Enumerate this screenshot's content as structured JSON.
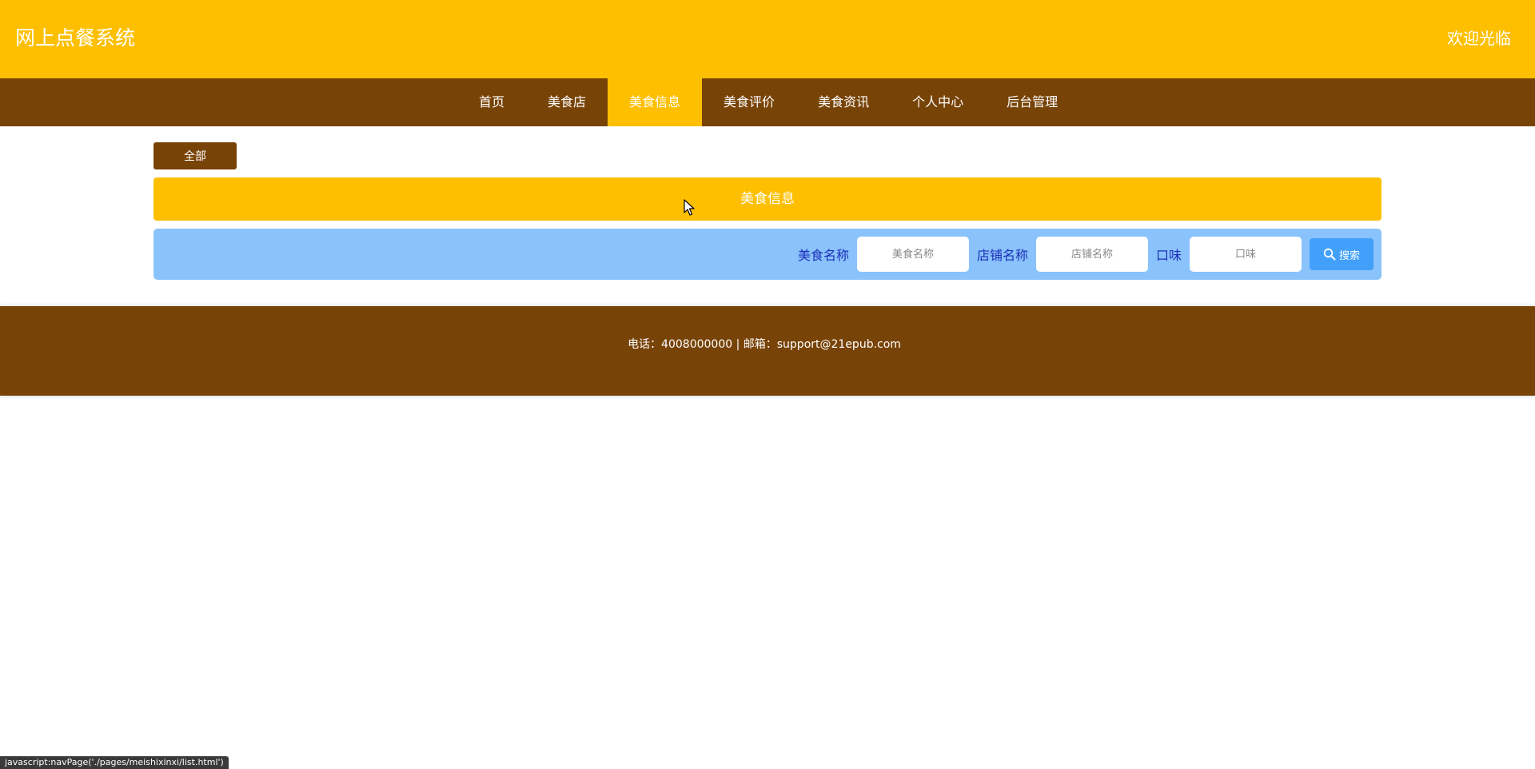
{
  "header": {
    "site_title": "网上点餐系统",
    "welcome": "欢迎光临"
  },
  "nav": {
    "items": [
      {
        "label": "首页"
      },
      {
        "label": "美食店"
      },
      {
        "label": "美食信息",
        "active": true
      },
      {
        "label": "美食评价"
      },
      {
        "label": "美食资讯"
      },
      {
        "label": "个人中心"
      },
      {
        "label": "后台管理"
      }
    ]
  },
  "filter": {
    "all_label": "全部"
  },
  "section": {
    "title": "美食信息"
  },
  "search": {
    "food_name_label": "美食名称",
    "food_name_placeholder": "美食名称",
    "shop_name_label": "店铺名称",
    "shop_name_placeholder": "店铺名称",
    "taste_label": "口味",
    "taste_placeholder": "口味",
    "button_label": "搜索",
    "button_icon": "search-icon"
  },
  "footer": {
    "contact": "电话：4008000000 | 邮箱：support@21epub.com"
  },
  "status_bar": {
    "url": "javascript:navPage('./pages/meishixinxi/list.html')"
  },
  "colors": {
    "header_bg": "#fdbf00",
    "nav_bg": "#784307",
    "search_bg": "#8ac2fb",
    "search_button": "#42a0fb",
    "label_text": "#1b2fb8"
  }
}
